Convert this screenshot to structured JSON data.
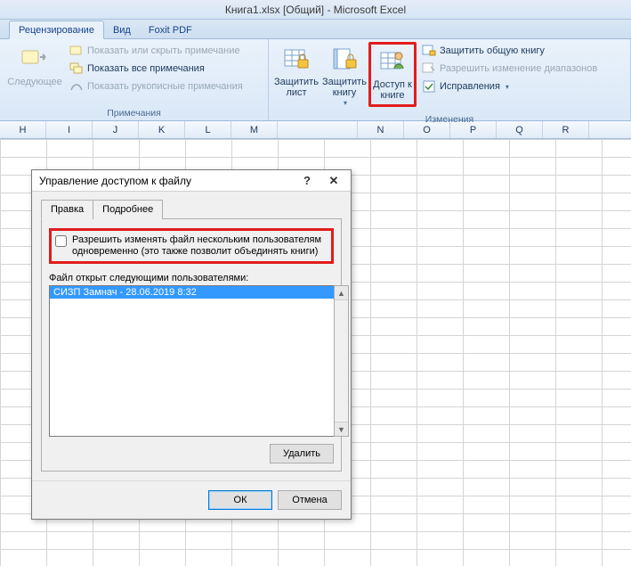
{
  "title": "Книга1.xlsx  [Общий] - Microsoft Excel",
  "tabs": {
    "review": "Рецензирование",
    "view": "Вид",
    "foxit": "Foxit PDF"
  },
  "group1": {
    "title": "Примечания",
    "prev": "Следующее",
    "a": "Показать или скрыть примечание",
    "b": "Показать все примечания",
    "c": "Показать рукописные примечания"
  },
  "group2": {
    "title": "Изменения",
    "protect_sheet": "Защитить лист",
    "protect_book": "Защитить книгу",
    "share_book": "Доступ к книге",
    "r1": "Защитить общую книгу",
    "r2": "Разрешить изменение диапазонов",
    "r3": "Исправления"
  },
  "cols": [
    "H",
    "I",
    "J",
    "K",
    "L",
    "M",
    "",
    "N",
    "O",
    "P",
    "Q",
    "R"
  ],
  "dlg": {
    "title": "Управление доступом к файлу",
    "tab1": "Правка",
    "tab2": "Подробнее",
    "chk": "Разрешить изменять файл нескольким пользователям одновременно (это также позволит объединять книги)",
    "users_lbl": "Файл открыт следующими пользователями:",
    "user0": "СИЗП Замнач - 28.06.2019 8:32",
    "del": "Удалить",
    "ok": "ОК",
    "cancel": "Отмена"
  }
}
